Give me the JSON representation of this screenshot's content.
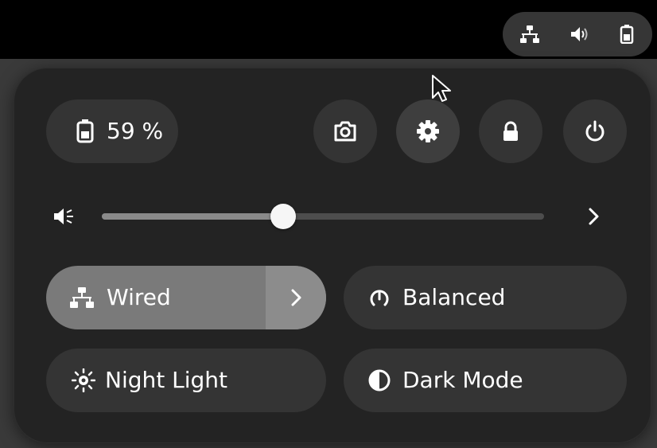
{
  "topbar": {
    "tray_icons": [
      "network-wired-icon",
      "volume-icon",
      "battery-icon"
    ]
  },
  "menu": {
    "battery": {
      "label": "59 %",
      "icon": "battery-icon"
    },
    "actions": [
      {
        "name": "screenshot",
        "icon": "camera-icon"
      },
      {
        "name": "settings",
        "icon": "gear-icon"
      },
      {
        "name": "lock",
        "icon": "lock-icon"
      },
      {
        "name": "power",
        "icon": "power-icon"
      }
    ],
    "volume": {
      "level": 0.41,
      "icon": "speaker-muted-icon",
      "more_icon": "chevron-right-icon"
    },
    "toggles": {
      "wired": {
        "label": "Wired",
        "icon": "network-wired-icon",
        "active": true
      },
      "balanced": {
        "label": "Balanced",
        "icon": "power-profile-icon",
        "active": false
      },
      "night_light": {
        "label": "Night Light",
        "icon": "night-light-icon",
        "active": false
      },
      "dark_mode": {
        "label": "Dark Mode",
        "icon": "dark-mode-icon",
        "active": false
      }
    }
  },
  "colors": {
    "background": "#3a3a3a",
    "panel": "#232323",
    "button": "#343434",
    "active_toggle": "#7a7a7a",
    "topbar": "#000000"
  }
}
